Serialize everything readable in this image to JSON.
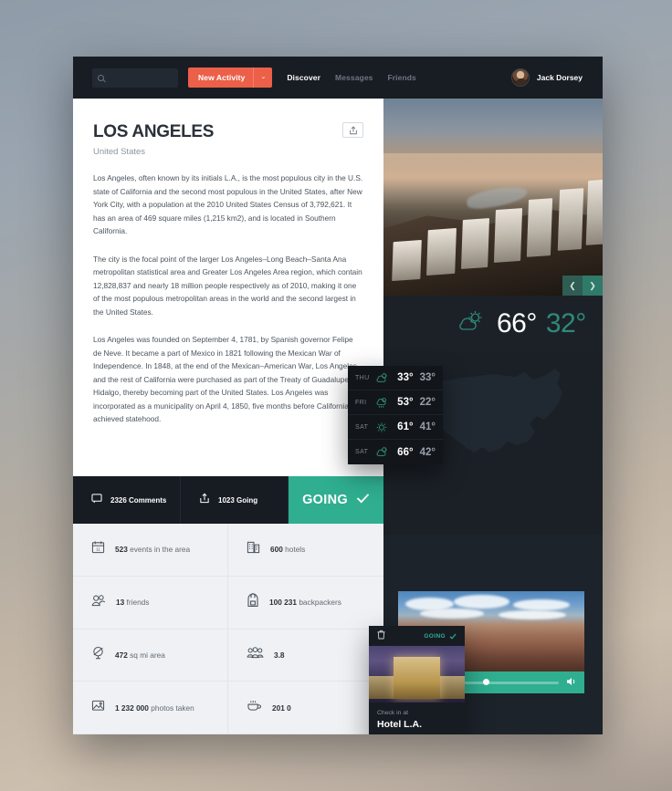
{
  "header": {
    "search_placeholder": "",
    "search_value": "",
    "new_activity_label": "New Activity",
    "new_activity_caret": "⌄",
    "nav": [
      {
        "label": "Discover",
        "state": "active"
      },
      {
        "label": "Messages",
        "state": "dim"
      },
      {
        "label": "Friends",
        "state": "dim"
      }
    ],
    "user_name": "Jack Dorsey"
  },
  "article": {
    "title": "LOS ANGELES",
    "country": "United States",
    "paragraphs": [
      "Los Angeles, often known by its initials L.A., is the most populous city in the U.S. state of California and the second most populous in the United States, after New York City, with a population at the 2010 United States Census of 3,792,621. It has an area of 469 square miles (1,215 km2), and is located in Southern California.",
      "The city is the focal point of the larger Los Angeles–Long Beach–Santa Ana metropolitan statistical area and Greater Los Angeles Area region, which contain 12,828,837 and nearly 18 million people respectively as of 2010, making it one of the most populous metropolitan areas in the world and the second largest in the United States.",
      "Los Angeles was founded on September 4, 1781, by Spanish governor Felipe de Neve. It became a part of Mexico in 1821 following the Mexican War of Independence. In 1848, at the end of the Mexican–American War, Los Angeles and the rest of California were purchased as part of the Treaty of Guadalupe Hidalgo, thereby becoming part of the United States. Los Angeles was incorporated as a municipality on April 4, 1850, five months before California achieved statehood."
    ]
  },
  "weather": {
    "current_high": "66°",
    "current_low": "32°",
    "forecast": [
      {
        "day": "THU",
        "icon": "sun-cloud-icon",
        "high": "33°",
        "low": "33°"
      },
      {
        "day": "FRI",
        "icon": "rain-cloud-icon",
        "high": "53°",
        "low": "22°"
      },
      {
        "day": "SAT",
        "icon": "sun-icon",
        "high": "61°",
        "low": "41°"
      },
      {
        "day": "SAT",
        "icon": "sun-cloud-icon",
        "high": "66°",
        "low": "42°"
      }
    ]
  },
  "actions": {
    "comments_label": "2326 Comments",
    "going_count_label": "1023 Going",
    "going_button_label": "GOING"
  },
  "stats": [
    {
      "icon": "calendar-icon",
      "value": "523",
      "label": "events in the area"
    },
    {
      "icon": "building-icon",
      "value": "600",
      "label": "hotels"
    },
    {
      "icon": "friends-icon",
      "value": "13",
      "label": "friends"
    },
    {
      "icon": "backpack-icon",
      "value": "100 231",
      "label": "backpackers"
    },
    {
      "icon": "area-icon",
      "value": "472",
      "label": "sq mi area"
    },
    {
      "icon": "people-group-icon",
      "value": "3.8",
      "label": ""
    },
    {
      "icon": "photo-icon",
      "value": "1 232 000",
      "label": "photos taken"
    },
    {
      "icon": "coffee-icon",
      "value": "201 0",
      "label": ""
    }
  ],
  "hotel_card": {
    "going_label": "GOING",
    "kicker": "Check in at",
    "name": "Hotel L.A.",
    "trash_icon": "trash-icon",
    "check_icon": "check-icon"
  },
  "video": {
    "pause_icon": "pause-icon",
    "volume_icon": "volume-icon",
    "progress_percent": 45
  },
  "carousel": {
    "prev_icon": "chevron-left-icon",
    "next_icon": "chevron-right-icon"
  },
  "footer": {
    "refresh_icon": "refresh-icon",
    "next_icon": "chevron-right-icon",
    "add_icon": "plus-icon",
    "steps": [
      "done",
      "skip",
      "done",
      "done",
      "current",
      "done",
      "done",
      "done",
      "todo",
      "todo",
      "todo"
    ]
  },
  "colors": {
    "accent_red": "#ec5f48",
    "accent_teal": "#2fae90",
    "panel_dark": "#171c23",
    "panel_darker": "#12161b",
    "page_light": "#eff1f4"
  }
}
